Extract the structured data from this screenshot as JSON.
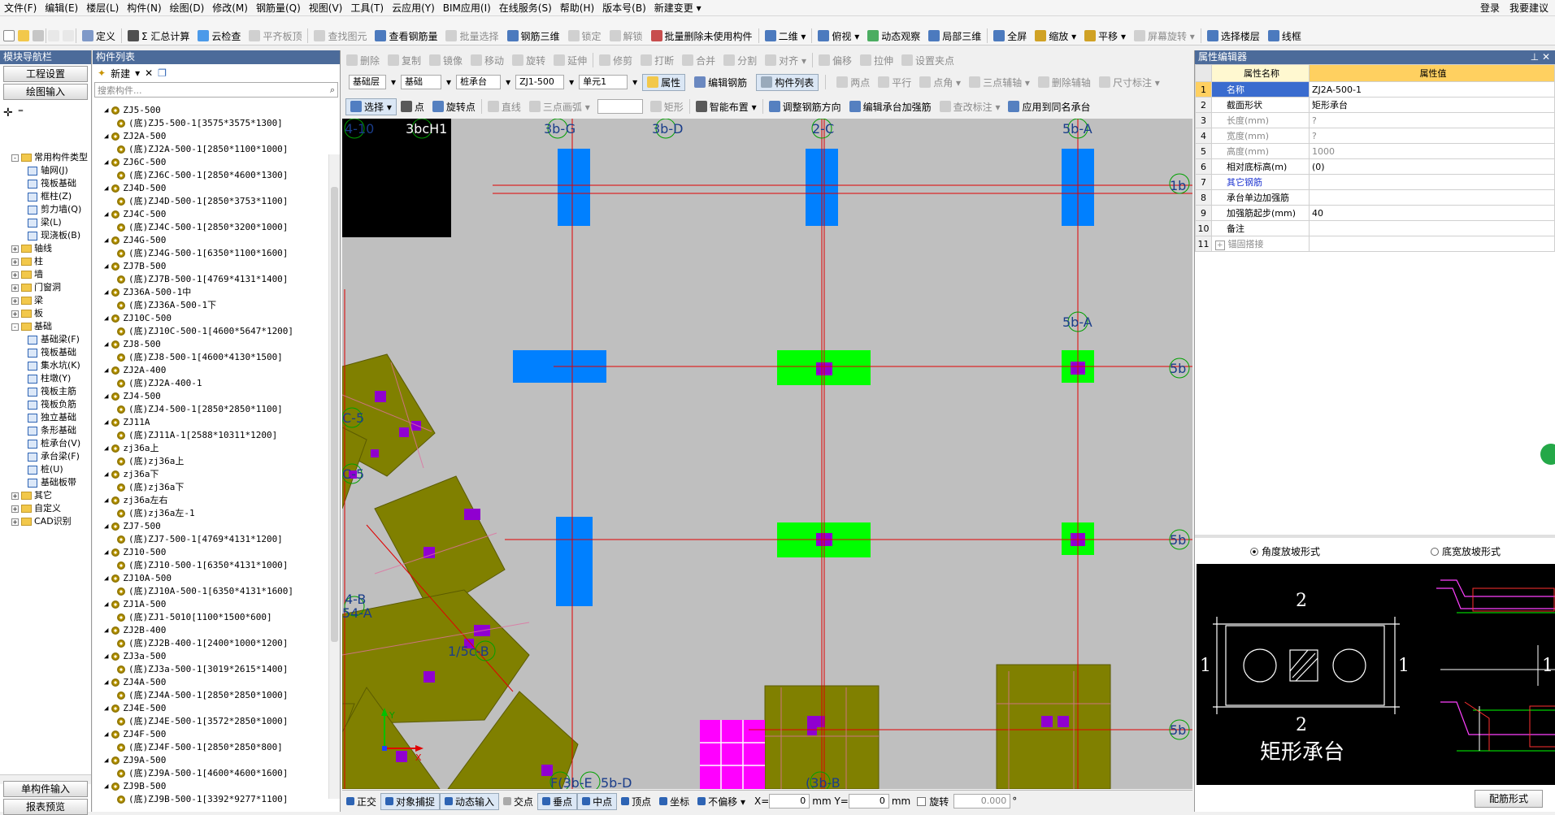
{
  "menu": [
    "文件(F)",
    "编辑(E)",
    "楼层(L)",
    "构件(N)",
    "绘图(D)",
    "修改(M)",
    "钢筋量(Q)",
    "视图(V)",
    "工具(T)",
    "云应用(Y)",
    "BIM应用(I)",
    "在线服务(S)",
    "帮助(H)",
    "版本号(B)",
    "新建变更 ▾"
  ],
  "menu_right": [
    "登录",
    "我要建议"
  ],
  "toolbar1": [
    {
      "label": "定义",
      "dis": false
    },
    {
      "label": "Σ 汇总计算",
      "dis": false
    },
    {
      "label": "云检查",
      "dis": false
    },
    {
      "label": "平齐板顶",
      "dis": true
    },
    {
      "label": "查找图元",
      "dis": true
    },
    {
      "label": "查看钢筋量",
      "dis": false
    },
    {
      "label": "批量选择",
      "dis": true
    },
    {
      "label": "钢筋三维",
      "dis": false
    },
    {
      "label": "锁定",
      "dis": true
    },
    {
      "label": "解锁",
      "dis": true
    },
    {
      "label": "批量删除未使用构件",
      "dis": false
    },
    {
      "label": "二维 ▾",
      "dis": false
    },
    {
      "label": "俯视 ▾",
      "dis": false
    },
    {
      "label": "动态观察",
      "dis": false
    },
    {
      "label": "局部三维",
      "dis": false
    },
    {
      "label": "全屏",
      "dis": false
    },
    {
      "label": "缩放 ▾",
      "dis": false
    },
    {
      "label": "平移 ▾",
      "dis": false
    },
    {
      "label": "屏幕旋转 ▾",
      "dis": true
    },
    {
      "label": "选择楼层",
      "dis": false
    },
    {
      "label": "线框",
      "dis": false
    }
  ],
  "toolbar2": [
    {
      "label": "删除",
      "dis": true
    },
    {
      "label": "复制",
      "dis": true
    },
    {
      "label": "镜像",
      "dis": true
    },
    {
      "label": "移动",
      "dis": true
    },
    {
      "label": "旋转",
      "dis": true
    },
    {
      "label": "延伸",
      "dis": true
    },
    {
      "label": "修剪",
      "dis": true
    },
    {
      "label": "打断",
      "dis": true
    },
    {
      "label": "合并",
      "dis": true
    },
    {
      "label": "分割",
      "dis": true
    },
    {
      "label": "对齐 ▾",
      "dis": true
    },
    {
      "label": "偏移",
      "dis": true
    },
    {
      "label": "拉伸",
      "dis": true
    },
    {
      "label": "设置夹点",
      "dis": true
    }
  ],
  "nav": {
    "title": "模块导航栏",
    "btn1": "工程设置",
    "btn2": "绘图输入",
    "bottom1": "单构件输入",
    "bottom2": "报表预览"
  },
  "tree": [
    {
      "t": "常用构件类型",
      "lvl": 1,
      "type": "folder",
      "exp": "-"
    },
    {
      "t": "轴网(J)",
      "lvl": 2,
      "type": "item"
    },
    {
      "t": "筏板基础",
      "lvl": 2,
      "type": "item"
    },
    {
      "t": "框柱(Z)",
      "lvl": 2,
      "type": "item"
    },
    {
      "t": "剪力墙(Q)",
      "lvl": 2,
      "type": "item"
    },
    {
      "t": "梁(L)",
      "lvl": 2,
      "type": "item"
    },
    {
      "t": "现浇板(B)",
      "lvl": 2,
      "type": "item"
    },
    {
      "t": "轴线",
      "lvl": 1,
      "type": "folder",
      "exp": "+"
    },
    {
      "t": "柱",
      "lvl": 1,
      "type": "folder",
      "exp": "+"
    },
    {
      "t": "墙",
      "lvl": 1,
      "type": "folder",
      "exp": "+"
    },
    {
      "t": "门窗洞",
      "lvl": 1,
      "type": "folder",
      "exp": "+"
    },
    {
      "t": "梁",
      "lvl": 1,
      "type": "folder",
      "exp": "+"
    },
    {
      "t": "板",
      "lvl": 1,
      "type": "folder",
      "exp": "+"
    },
    {
      "t": "基础",
      "lvl": 1,
      "type": "folder",
      "exp": "-"
    },
    {
      "t": "基础梁(F)",
      "lvl": 2,
      "type": "item"
    },
    {
      "t": "筏板基础",
      "lvl": 2,
      "type": "item"
    },
    {
      "t": "集水坑(K)",
      "lvl": 2,
      "type": "item"
    },
    {
      "t": "柱墩(Y)",
      "lvl": 2,
      "type": "item"
    },
    {
      "t": "筏板主筋",
      "lvl": 2,
      "type": "item"
    },
    {
      "t": "筏板负筋",
      "lvl": 2,
      "type": "item"
    },
    {
      "t": "独立基础",
      "lvl": 2,
      "type": "item"
    },
    {
      "t": "条形基础",
      "lvl": 2,
      "type": "item"
    },
    {
      "t": "桩承台(V)",
      "lvl": 2,
      "type": "item"
    },
    {
      "t": "承台梁(F)",
      "lvl": 2,
      "type": "item"
    },
    {
      "t": "桩(U)",
      "lvl": 2,
      "type": "item"
    },
    {
      "t": "基础板带",
      "lvl": 2,
      "type": "item"
    },
    {
      "t": "其它",
      "lvl": 1,
      "type": "folder",
      "exp": "+"
    },
    {
      "t": "自定义",
      "lvl": 1,
      "type": "folder",
      "exp": "+"
    },
    {
      "t": "CAD识别",
      "lvl": 1,
      "type": "folder",
      "exp": "+"
    }
  ],
  "clist": {
    "title": "构件列表",
    "new_btn": "新建",
    "search_placeholder": "搜索构件...",
    "rows": [
      {
        "t": "ZJ5-500",
        "l": 1
      },
      {
        "t": "(底)ZJ5-500-1[3575*3575*1300]",
        "l": 2
      },
      {
        "t": "ZJ2A-500",
        "l": 1
      },
      {
        "t": "(底)ZJ2A-500-1[2850*1100*1000]",
        "l": 2
      },
      {
        "t": "ZJ6C-500",
        "l": 1
      },
      {
        "t": "(底)ZJ6C-500-1[2850*4600*1300]",
        "l": 2
      },
      {
        "t": "ZJ4D-500",
        "l": 1
      },
      {
        "t": "(底)ZJ4D-500-1[2850*3753*1100]",
        "l": 2
      },
      {
        "t": "ZJ4C-500",
        "l": 1
      },
      {
        "t": "(底)ZJ4C-500-1[2850*3200*1000]",
        "l": 2
      },
      {
        "t": "ZJ4G-500",
        "l": 1
      },
      {
        "t": "(底)ZJ4G-500-1[6350*1100*1600]",
        "l": 2
      },
      {
        "t": "ZJ7B-500",
        "l": 1
      },
      {
        "t": "(底)ZJ7B-500-1[4769*4131*1400]",
        "l": 2
      },
      {
        "t": "ZJ36A-500-1中",
        "l": 1
      },
      {
        "t": "(底)ZJ36A-500-1下",
        "l": 2
      },
      {
        "t": "ZJ10C-500",
        "l": 1
      },
      {
        "t": "(底)ZJ10C-500-1[4600*5647*1200]",
        "l": 2
      },
      {
        "t": "ZJ8-500",
        "l": 1
      },
      {
        "t": "(底)ZJ8-500-1[4600*4130*1500]",
        "l": 2
      },
      {
        "t": "ZJ2A-400",
        "l": 1
      },
      {
        "t": "(底)ZJ2A-400-1",
        "l": 2
      },
      {
        "t": "ZJ4-500",
        "l": 1
      },
      {
        "t": "(底)ZJ4-500-1[2850*2850*1100]",
        "l": 2
      },
      {
        "t": "ZJ11A",
        "l": 1
      },
      {
        "t": "(底)ZJ11A-1[2588*10311*1200]",
        "l": 2
      },
      {
        "t": "zj36a上",
        "l": 1
      },
      {
        "t": "(底)zj36a上",
        "l": 2
      },
      {
        "t": "zj36a下",
        "l": 1
      },
      {
        "t": "(底)zj36a下",
        "l": 2
      },
      {
        "t": "zj36a左右",
        "l": 1
      },
      {
        "t": "(底)zj36a左-1",
        "l": 2
      },
      {
        "t": "ZJ7-500",
        "l": 1
      },
      {
        "t": "(底)ZJ7-500-1[4769*4131*1200]",
        "l": 2
      },
      {
        "t": "ZJ10-500",
        "l": 1
      },
      {
        "t": "(底)ZJ10-500-1[6350*4131*1000]",
        "l": 2
      },
      {
        "t": "ZJ10A-500",
        "l": 1
      },
      {
        "t": "(底)ZJ10A-500-1[6350*4131*1600]",
        "l": 2
      },
      {
        "t": "ZJ1A-500",
        "l": 1
      },
      {
        "t": "(底)ZJ1-5010[1100*1500*600]",
        "l": 2
      },
      {
        "t": "ZJ2B-400",
        "l": 1
      },
      {
        "t": "(底)ZJ2B-400-1[2400*1000*1200]",
        "l": 2
      },
      {
        "t": "ZJ3a-500",
        "l": 1
      },
      {
        "t": "(底)ZJ3a-500-1[3019*2615*1400]",
        "l": 2
      },
      {
        "t": "ZJ4A-500",
        "l": 1
      },
      {
        "t": "(底)ZJ4A-500-1[2850*2850*1000]",
        "l": 2
      },
      {
        "t": "ZJ4E-500",
        "l": 1
      },
      {
        "t": "(底)ZJ4E-500-1[3572*2850*1000]",
        "l": 2
      },
      {
        "t": "ZJ4F-500",
        "l": 1
      },
      {
        "t": "(底)ZJ4F-500-1[2850*2850*800]",
        "l": 2
      },
      {
        "t": "ZJ9A-500",
        "l": 1
      },
      {
        "t": "(底)ZJ9A-500-1[4600*4600*1600]",
        "l": 2
      },
      {
        "t": "ZJ9B-500",
        "l": 1
      },
      {
        "t": "(底)ZJ9B-500-1[3392*9277*1100]",
        "l": 2
      }
    ]
  },
  "selectors": {
    "floor": "基础层",
    "category": "基础",
    "type": "桩承台",
    "component": "ZJ1-500",
    "unit": "单元1",
    "attr_btn": "属性",
    "edit_rebar": "编辑钢筋",
    "comp_list": "构件列表"
  },
  "toolbar3": [
    {
      "label": "两点",
      "dis": true
    },
    {
      "label": "平行",
      "dis": true
    },
    {
      "label": "点角 ▾",
      "dis": true
    },
    {
      "label": "三点辅轴 ▾",
      "dis": true
    },
    {
      "label": "删除辅轴",
      "dis": true
    },
    {
      "label": "尺寸标注 ▾",
      "dis": true
    }
  ],
  "toolbar4": [
    {
      "label": "选择 ▾",
      "dis": false
    },
    {
      "label": "点",
      "dis": false
    },
    {
      "label": "旋转点",
      "dis": false
    },
    {
      "label": "直线",
      "dis": true
    },
    {
      "label": "三点画弧 ▾",
      "dis": true
    },
    {
      "label": "矩形",
      "dis": true
    },
    {
      "label": "智能布置 ▾",
      "dis": false
    },
    {
      "label": "调整钢筋方向",
      "dis": false
    },
    {
      "label": "编辑承台加强筋",
      "dis": false
    },
    {
      "label": "查改标注 ▾",
      "dis": true
    },
    {
      "label": "应用到同名承台",
      "dis": false
    }
  ],
  "prop": {
    "title": "属性编辑器",
    "col_name": "属性名称",
    "col_value": "属性值",
    "rows": [
      {
        "i": "1",
        "n": "名称",
        "v": "ZJ2A-500-1",
        "nc": "blue",
        "vc": ""
      },
      {
        "i": "2",
        "n": "截面形状",
        "v": "矩形承台",
        "nc": "",
        "vc": ""
      },
      {
        "i": "3",
        "n": "长度(mm)",
        "v": "?",
        "nc": "gray",
        "vc": "gray"
      },
      {
        "i": "4",
        "n": "宽度(mm)",
        "v": "?",
        "nc": "gray",
        "vc": "gray"
      },
      {
        "i": "5",
        "n": "高度(mm)",
        "v": "1000",
        "nc": "gray",
        "vc": "gray"
      },
      {
        "i": "6",
        "n": "相对底标高(m)",
        "v": "(0)",
        "nc": "",
        "vc": ""
      },
      {
        "i": "7",
        "n": "其它钢筋",
        "v": "",
        "nc": "blue",
        "vc": ""
      },
      {
        "i": "8",
        "n": "承台单边加强筋",
        "v": "",
        "nc": "",
        "vc": ""
      },
      {
        "i": "9",
        "n": "加强筋起步(mm)",
        "v": "40",
        "nc": "",
        "vc": ""
      },
      {
        "i": "10",
        "n": "备注",
        "v": "",
        "nc": "",
        "vc": ""
      },
      {
        "i": "11",
        "n": "锚固搭接",
        "v": "",
        "nc": "gray",
        "vc": ""
      }
    ],
    "radio1": "角度放坡形式",
    "radio2": "底宽放坡形式",
    "preview_title": "矩形承台",
    "rebar_btn": "配筋形式",
    "dim_top": "2",
    "dim_bottom": "2",
    "dim_left": "1",
    "dim_right": "1",
    "dim_small": "1"
  },
  "status": {
    "items": [
      {
        "label": "正交"
      },
      {
        "label": "对象捕捉"
      },
      {
        "label": "动态输入"
      },
      {
        "label": "交点"
      },
      {
        "label": "垂点"
      },
      {
        "label": "中点"
      },
      {
        "label": "顶点"
      },
      {
        "label": "坐标"
      },
      {
        "label": "不偏移 ▾"
      }
    ],
    "x_label": "X=",
    "x_val": "0",
    "y_label": "mm Y=",
    "y_val": "0",
    "mm": "mm",
    "rotate": "旋转",
    "rotate_val": "0.000",
    "deg": "°"
  },
  "axis_labels": {
    "top": [
      "4-10",
      "3bcH1",
      "3b-G",
      "3b-D",
      "2-C",
      "5b-A"
    ],
    "right": [
      "5b",
      "5b",
      "5b",
      "5b-A"
    ],
    "left": [
      "C-5",
      "C-5",
      "4-B",
      "54-A",
      "1/5c-B"
    ],
    "bottom": [
      "F(3b-E",
      "5b-D",
      "(3b-B"
    ],
    "right_stack": "1b"
  },
  "colors": {
    "accent": "#4c6b9a",
    "canvas": "#bfbfbf",
    "pile_blue": "#0080ff",
    "pile_green": "#00ff00",
    "olive": "#808000",
    "magenta": "#ff00ff",
    "purple": "#9000d0",
    "gridline": "#e00000"
  }
}
